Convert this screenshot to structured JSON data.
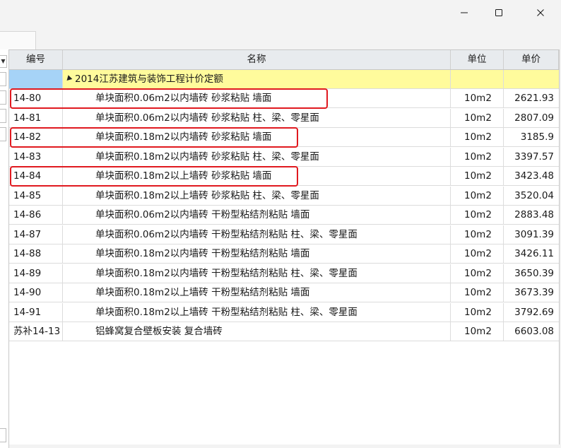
{
  "window": {
    "minimize_label": "minimize",
    "maximize_label": "maximize",
    "close_label": "close"
  },
  "table": {
    "headers": {
      "code": "编号",
      "name": "名称",
      "unit": "单位",
      "price": "单价"
    },
    "group": {
      "name": "2014江苏建筑与装饰工程计价定额"
    },
    "rows": [
      {
        "code": "14-80",
        "name": "单块面积0.06m2以内墙砖 砂浆粘贴 墙面",
        "unit": "10m2",
        "price": "2621.93",
        "highlighted": true
      },
      {
        "code": "14-81",
        "name": "单块面积0.06m2以内墙砖 砂浆粘贴 柱、梁、零星面",
        "unit": "10m2",
        "price": "2807.09",
        "highlighted": false
      },
      {
        "code": "14-82",
        "name": "单块面积0.18m2以内墙砖 砂浆粘贴 墙面",
        "unit": "10m2",
        "price": "3185.9",
        "highlighted": true
      },
      {
        "code": "14-83",
        "name": "单块面积0.18m2以内墙砖 砂浆粘贴 柱、梁、零星面",
        "unit": "10m2",
        "price": "3397.57",
        "highlighted": false
      },
      {
        "code": "14-84",
        "name": "单块面积0.18m2以上墙砖 砂浆粘贴 墙面",
        "unit": "10m2",
        "price": "3423.48",
        "highlighted": true
      },
      {
        "code": "14-85",
        "name": "单块面积0.18m2以上墙砖 砂浆粘贴 柱、梁、零星面",
        "unit": "10m2",
        "price": "3520.04",
        "highlighted": false
      },
      {
        "code": "14-86",
        "name": "单块面积0.06m2以内墙砖 干粉型粘结剂粘贴 墙面",
        "unit": "10m2",
        "price": "2883.48",
        "highlighted": false
      },
      {
        "code": "14-87",
        "name": "单块面积0.06m2以内墙砖 干粉型粘结剂粘贴 柱、梁、零星面",
        "unit": "10m2",
        "price": "3091.39",
        "highlighted": false
      },
      {
        "code": "14-88",
        "name": "单块面积0.18m2以内墙砖 干粉型粘结剂粘贴 墙面",
        "unit": "10m2",
        "price": "3426.11",
        "highlighted": false
      },
      {
        "code": "14-89",
        "name": "单块面积0.18m2以内墙砖 干粉型粘结剂粘贴 柱、梁、零星面",
        "unit": "10m2",
        "price": "3650.39",
        "highlighted": false
      },
      {
        "code": "14-90",
        "name": "单块面积0.18m2以上墙砖 干粉型粘结剂粘贴 墙面",
        "unit": "10m2",
        "price": "3673.39",
        "highlighted": false
      },
      {
        "code": "14-91",
        "name": "单块面积0.18m2以上墙砖 干粉型粘结剂粘贴 柱、梁、零星面",
        "unit": "10m2",
        "price": "3792.69",
        "highlighted": false
      },
      {
        "code": "苏补14-13",
        "name": "铝蜂窝复合壁板安装 复合墙砖",
        "unit": "10m2",
        "price": "6603.08",
        "highlighted": false
      }
    ]
  },
  "colors": {
    "header_bg": "#e8ebee",
    "group_bg": "#fffb9c",
    "group_code_bg": "#a6d3f7",
    "highlight_border": "#e0191f"
  }
}
